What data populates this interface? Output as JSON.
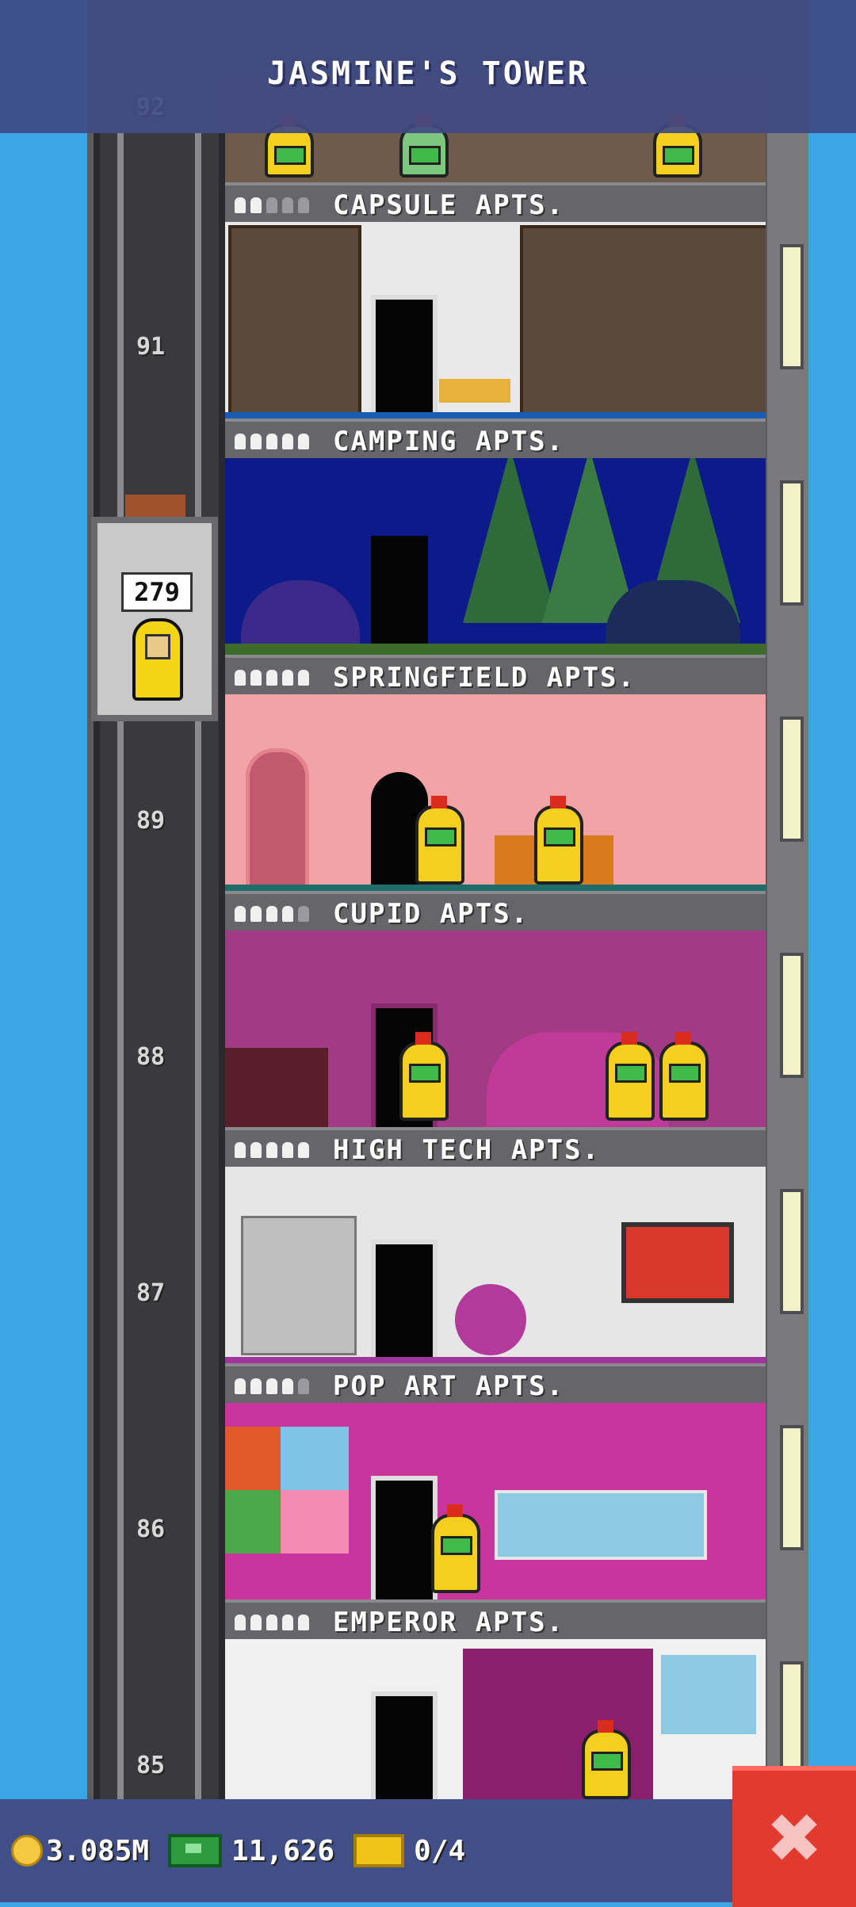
{
  "title": "JASMINE'S TOWER",
  "elevator": {
    "count": "279"
  },
  "floor_numbers": [
    "92",
    "91",
    "89",
    "88",
    "87",
    "86",
    "85"
  ],
  "floors": [
    {
      "name": "CAPSULE APTS.",
      "stars": 2
    },
    {
      "name": "CAMPING APTS.",
      "stars": 5
    },
    {
      "name": "SPRINGFIELD APTS.",
      "stars": 5
    },
    {
      "name": "CUPID APTS.",
      "stars": 4
    },
    {
      "name": "HIGH TECH APTS.",
      "stars": 5
    },
    {
      "name": "POP ART APTS.",
      "stars": 4
    },
    {
      "name": "EMPEROR APTS.",
      "stars": 5
    }
  ],
  "status": {
    "coins": "3.085M",
    "bux": "11,626",
    "tickets": "0/4"
  },
  "icons": {
    "coin": "coin-icon",
    "bux": "cash-icon",
    "ticket": "ticket-icon",
    "close": "close-icon"
  },
  "colors": {
    "sky": "#3aa6e6",
    "bar": "#404a82",
    "close": "#e23a2e"
  }
}
